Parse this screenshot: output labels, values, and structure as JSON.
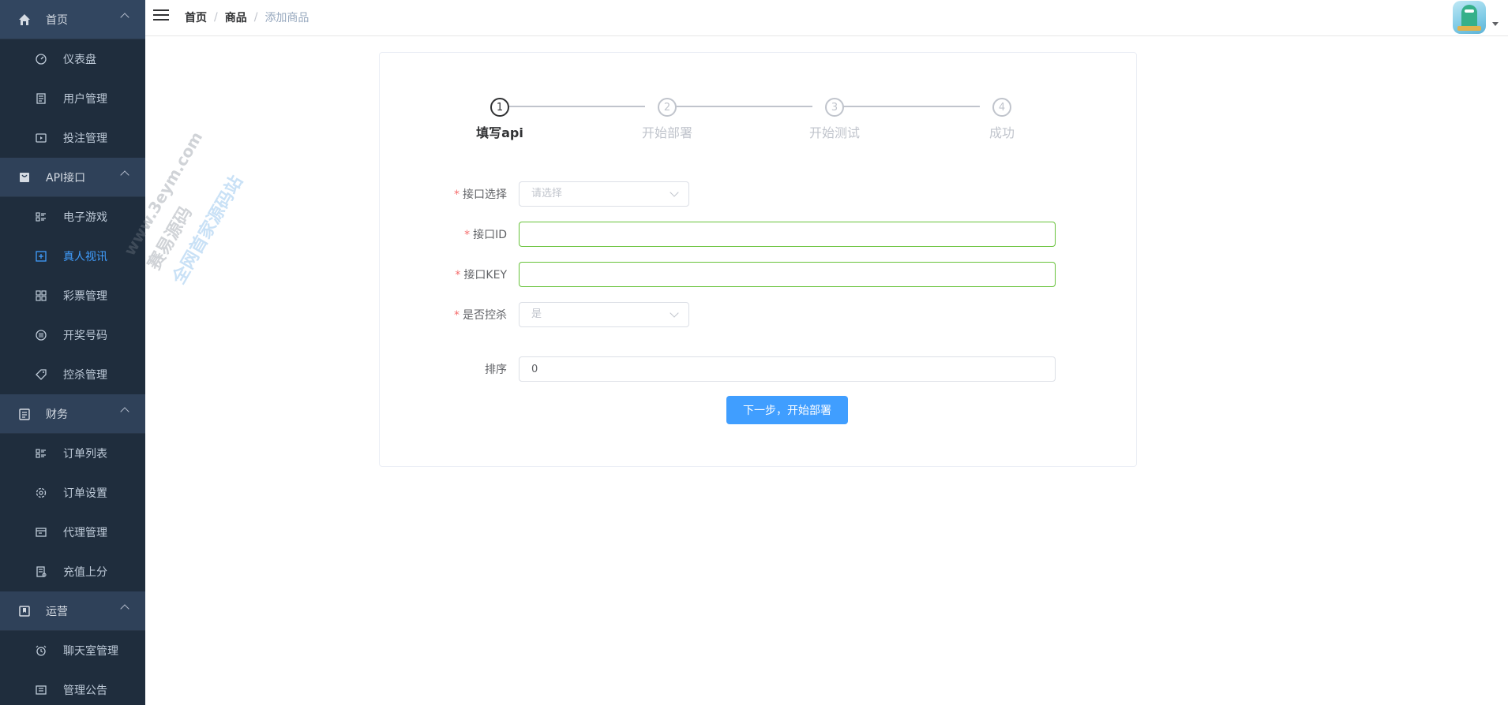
{
  "sidebar": {
    "groups": [
      {
        "label": "首页",
        "icon": "home-icon",
        "items": [
          {
            "label": "仪表盘",
            "icon": "dashboard-icon"
          },
          {
            "label": "用户管理",
            "icon": "document-icon"
          },
          {
            "label": "投注管理",
            "icon": "play-icon"
          }
        ]
      },
      {
        "label": "API接口",
        "icon": "bag-icon",
        "items": [
          {
            "label": "电子游戏",
            "icon": "list-icon"
          },
          {
            "label": "真人视讯",
            "icon": "plus-square-icon",
            "active": true
          },
          {
            "label": "彩票管理",
            "icon": "grid-icon"
          },
          {
            "label": "开奖号码",
            "icon": "circle-list-icon"
          },
          {
            "label": "控杀管理",
            "icon": "tag-icon"
          }
        ]
      },
      {
        "label": "财务",
        "icon": "clipboard-icon",
        "items": [
          {
            "label": "订单列表",
            "icon": "list-icon"
          },
          {
            "label": "订单设置",
            "icon": "gear-icon"
          },
          {
            "label": "代理管理",
            "icon": "window-icon"
          },
          {
            "label": "充值上分",
            "icon": "receipt-icon"
          }
        ]
      },
      {
        "label": "运营",
        "icon": "bookmark-icon",
        "items": [
          {
            "label": "聊天室管理",
            "icon": "alarm-clock-icon"
          },
          {
            "label": "管理公告",
            "icon": "notice-icon"
          }
        ]
      }
    ]
  },
  "header": {
    "breadcrumb": [
      "首页",
      "商品",
      "添加商品"
    ]
  },
  "steps": [
    {
      "number": "1",
      "title": "填写api",
      "active": true
    },
    {
      "number": "2",
      "title": "开始部署",
      "active": false
    },
    {
      "number": "3",
      "title": "开始测试",
      "active": false
    },
    {
      "number": "4",
      "title": "成功",
      "active": false
    }
  ],
  "form": {
    "api_select": {
      "label": "接口选择",
      "placeholder": "请选择"
    },
    "api_id": {
      "label": "接口ID",
      "value": ""
    },
    "api_key": {
      "label": "接口KEY",
      "value": ""
    },
    "kill_control": {
      "label": "是否控杀",
      "value": "是"
    },
    "sort": {
      "label": "排序",
      "value": "0"
    },
    "next_button": "下一步，开始部署"
  },
  "watermark": {
    "url": "www.3eym.com",
    "line1": "赛易源码",
    "line2": "全网首家源码站"
  },
  "colors": {
    "sidebar_bg": "#304156",
    "sub_menu_bg": "#1f2d3d",
    "active": "#409eff",
    "primary_button": "#409eff",
    "valid_border": "#67c23a",
    "required": "#f56c6c"
  }
}
